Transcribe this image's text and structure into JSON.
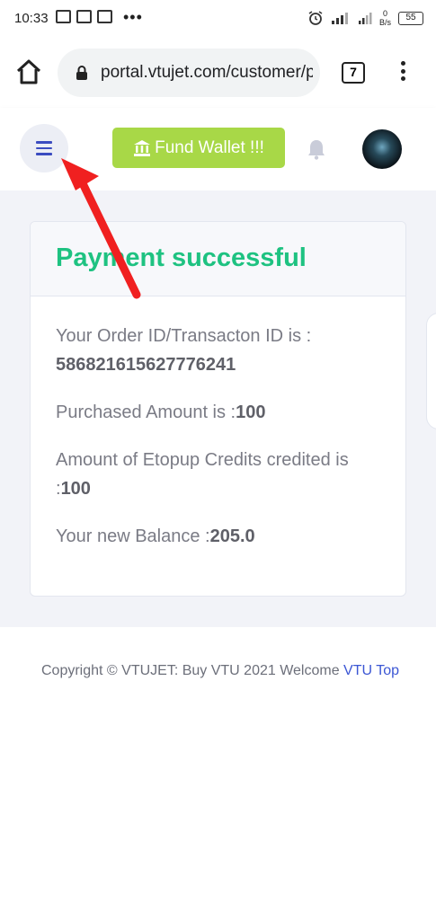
{
  "status_bar": {
    "time": "10:33",
    "net_speed_top": "0",
    "net_speed_unit": "B/s",
    "battery": "55"
  },
  "browser": {
    "url": "portal.vtujet.com/customer/pa",
    "tab_count": "7"
  },
  "header": {
    "fund_wallet_label": "Fund Wallet !!!"
  },
  "card": {
    "title": "Payment successful",
    "order_label": "Your Order ID/Transacton ID is :",
    "order_id": "586821615627776241",
    "purchased_label": "Purchased Amount is :",
    "purchased_value": "100",
    "credits_label": "Amount of Etopup Credits credited is :",
    "credits_value": "100",
    "balance_label": "Your new Balance :",
    "balance_value": "205.0"
  },
  "footer": {
    "text": "Copyright © VTUJET: Buy VTU 2021 Welcome",
    "link": "VTU Top"
  },
  "colors": {
    "success": "#1ec281",
    "fund_button": "#a8d847",
    "link": "#3b56d4",
    "annotation_arrow": "#f02020"
  }
}
